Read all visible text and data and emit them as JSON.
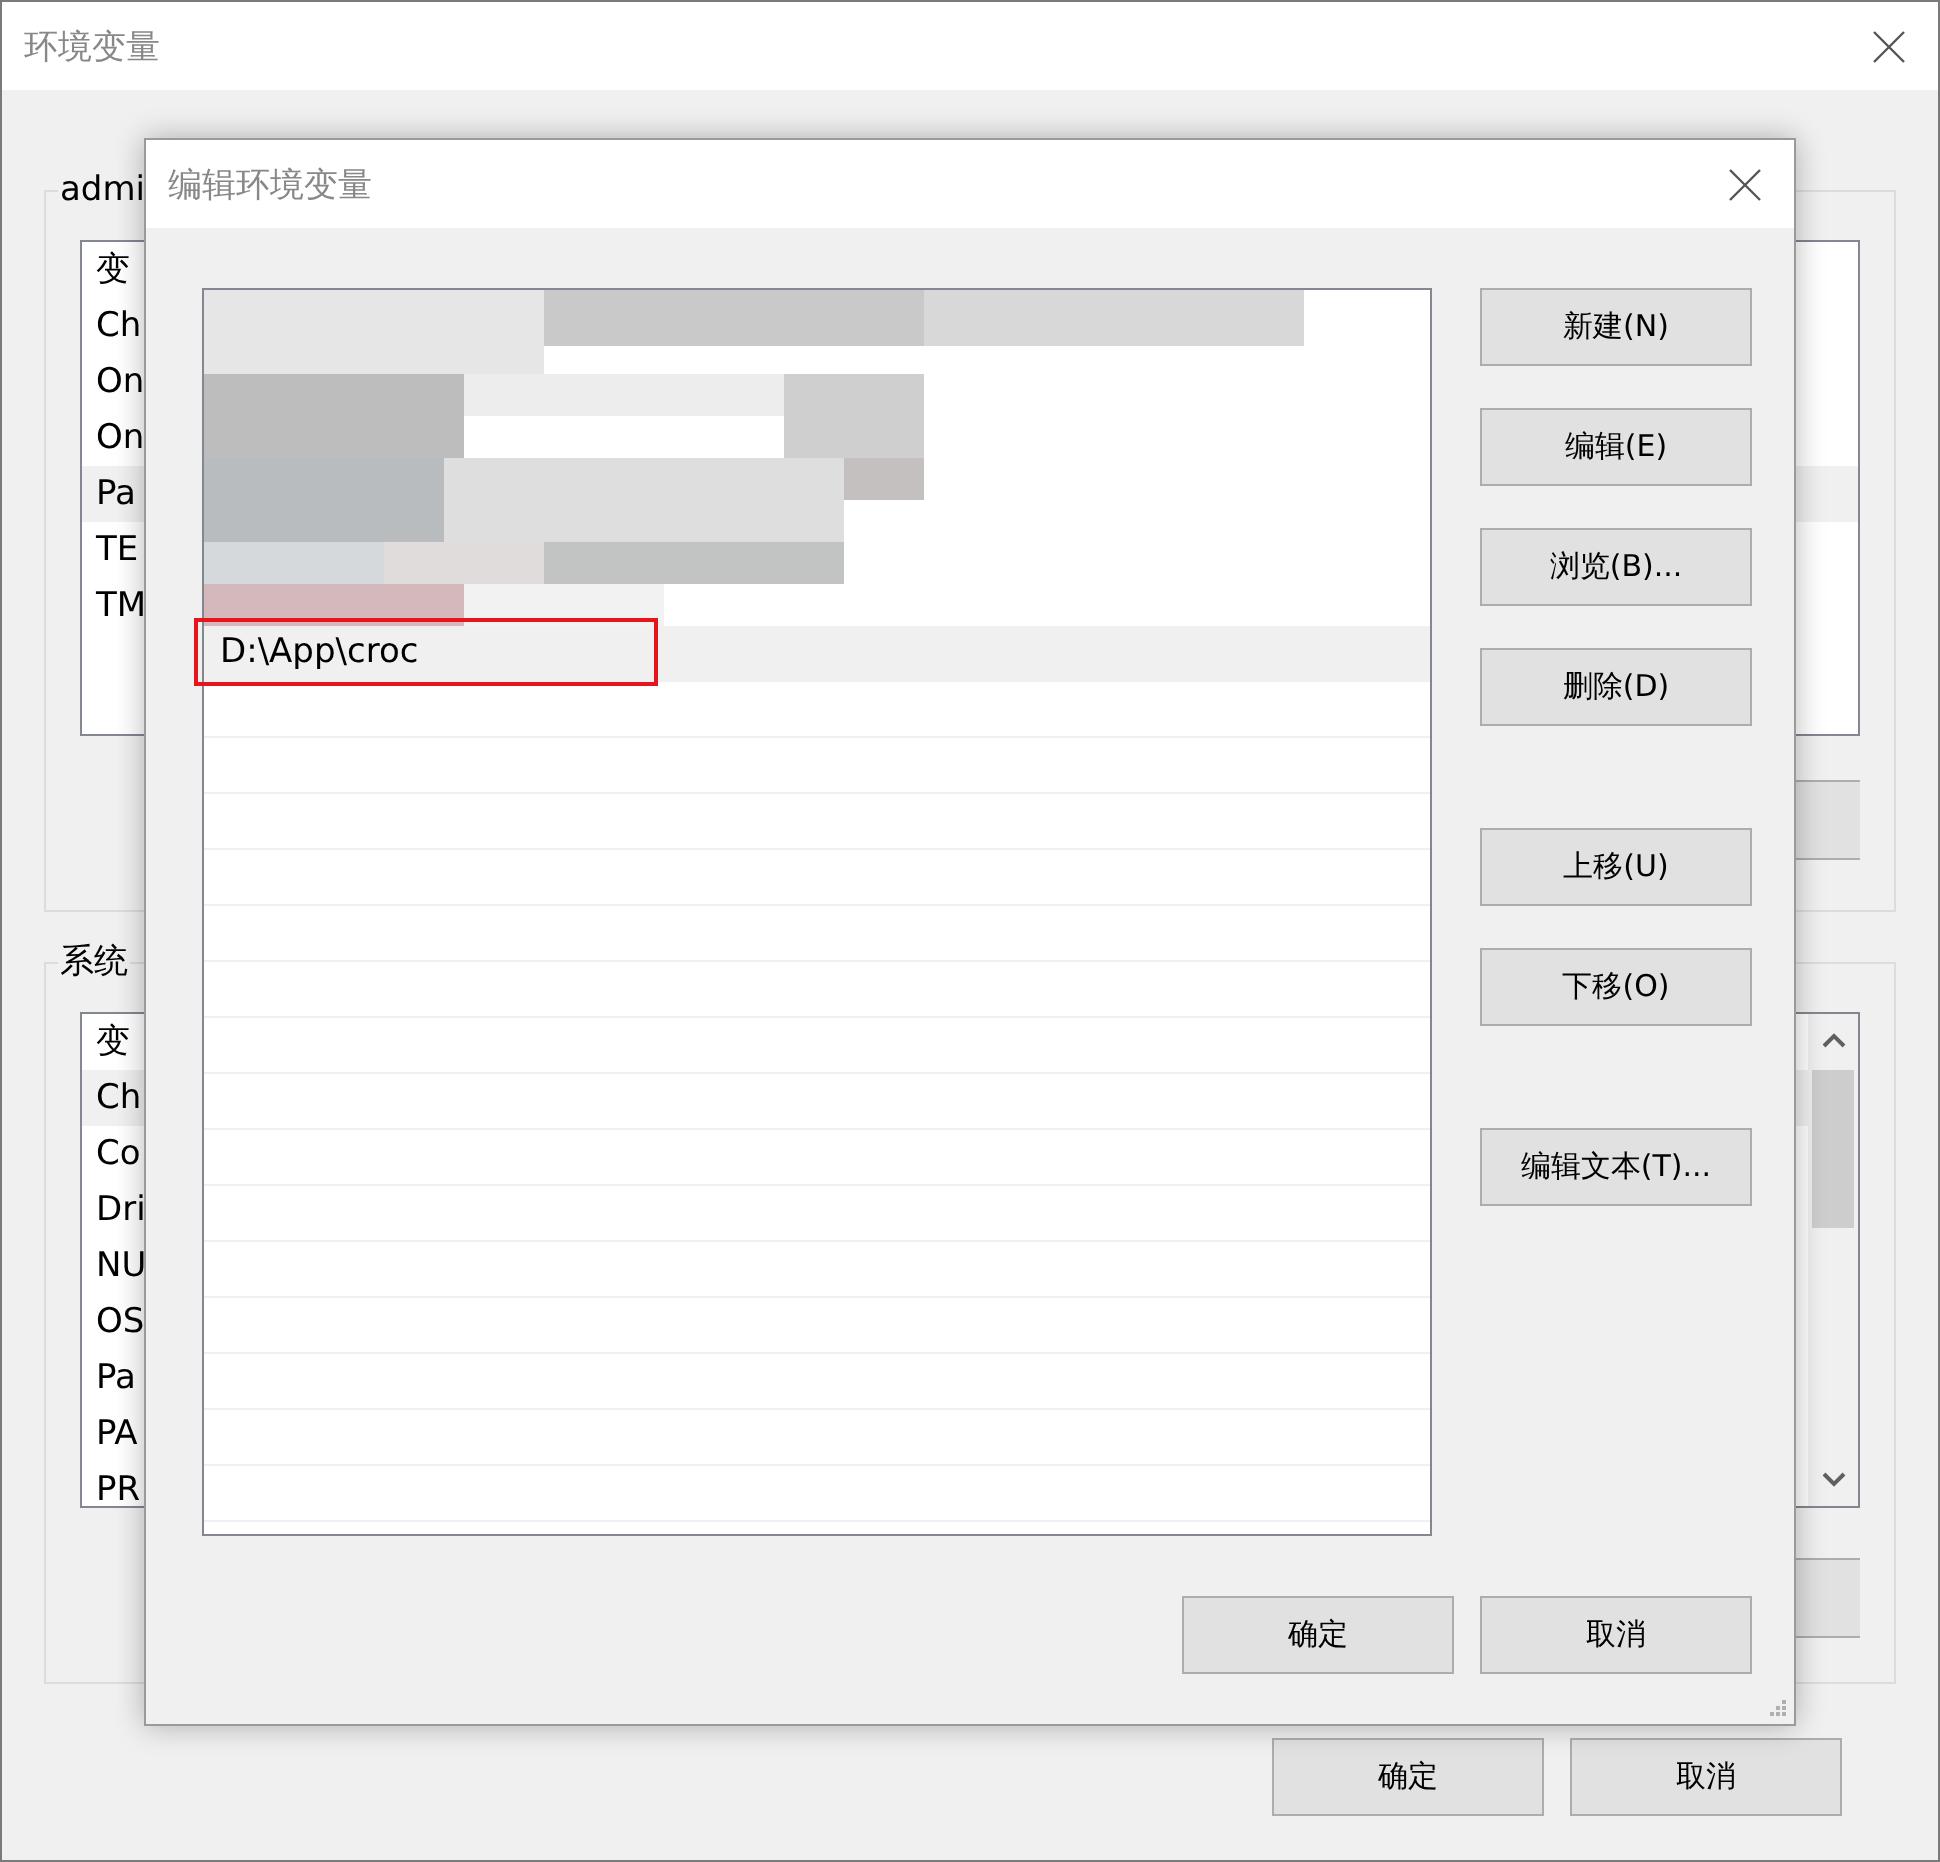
{
  "window": {
    "title": "环境变量"
  },
  "user_group": {
    "label": "admi",
    "header": "变",
    "items": [
      {
        "name": "Ch",
        "selected": false
      },
      {
        "name": "On",
        "selected": false
      },
      {
        "name": "On",
        "selected": false
      },
      {
        "name": "Pa",
        "selected": true
      },
      {
        "name": "TE",
        "selected": false
      },
      {
        "name": "TM",
        "selected": false
      }
    ]
  },
  "system_group": {
    "label": "系统",
    "header": "变",
    "items": [
      {
        "name": "Ch",
        "selected": true
      },
      {
        "name": "Co",
        "selected": false
      },
      {
        "name": "Dri",
        "selected": false
      },
      {
        "name": "NU",
        "selected": false
      },
      {
        "name": "OS",
        "selected": false
      },
      {
        "name": "Pa",
        "selected": false
      },
      {
        "name": "PA",
        "selected": false
      },
      {
        "name": "PR",
        "selected": false
      }
    ]
  },
  "buttons": [
    "确定",
    "取消"
  ],
  "dialog": {
    "title": "编辑环境变量",
    "entries": [
      {
        "kind": "redacted"
      },
      {
        "kind": "text",
        "text": "D:\\App\\croc",
        "selected": true,
        "annotated": true
      }
    ],
    "side_buttons": [
      {
        "label": "新建(N)",
        "spaced_before": false
      },
      {
        "label": "编辑(E)",
        "spaced_before": false
      },
      {
        "label": "浏览(B)...",
        "spaced_before": false
      },
      {
        "label": "删除(D)",
        "spaced_before": false
      },
      {
        "label": "上移(U)",
        "spaced_before": true
      },
      {
        "label": "下移(O)",
        "spaced_before": false
      },
      {
        "label": "编辑文本(T)...",
        "spaced_before": true
      }
    ],
    "buttons": [
      "确定",
      "取消"
    ]
  }
}
